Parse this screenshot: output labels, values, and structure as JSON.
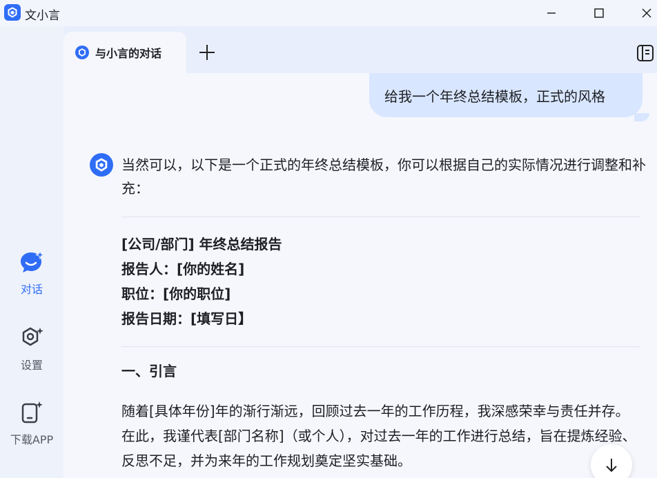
{
  "window": {
    "title": "文小言"
  },
  "sidebar": {
    "items": [
      {
        "label": "对话",
        "icon": "chat-bubble-icon",
        "active": true
      },
      {
        "label": "设置",
        "icon": "settings-icon",
        "active": false
      },
      {
        "label": "下载APP",
        "icon": "phone-download-icon",
        "active": false
      }
    ]
  },
  "tabs": [
    {
      "label": "与小言的对话",
      "icon": "app-logo-icon"
    }
  ],
  "conversation": {
    "user_message": "给我一个年终总结模板，正式的风格",
    "bot_intro": "当然可以，以下是一个正式的年终总结模板，你可以根据自己的实际情况进行调整和补充：",
    "header_lines": [
      "[公司/部门] 年终总结报告",
      "报告人：[你的姓名]",
      "职位：[你的职位]",
      "报告日期：[填写日】"
    ],
    "section_title": "一、引言",
    "section_body": "随着[具体年份]年的渐行渐远，回顾过去一年的工作历程，我深感荣幸与责任并存。在此，我谨代表[部门名称]（或个人），对过去一年的工作进行总结，旨在提炼经验、反思不足，并为来年的工作规划奠定坚实基础。"
  },
  "colors": {
    "accent": "#2f6df6",
    "user_bubble": "#d8e6ff",
    "background": "#f5f7fd"
  }
}
